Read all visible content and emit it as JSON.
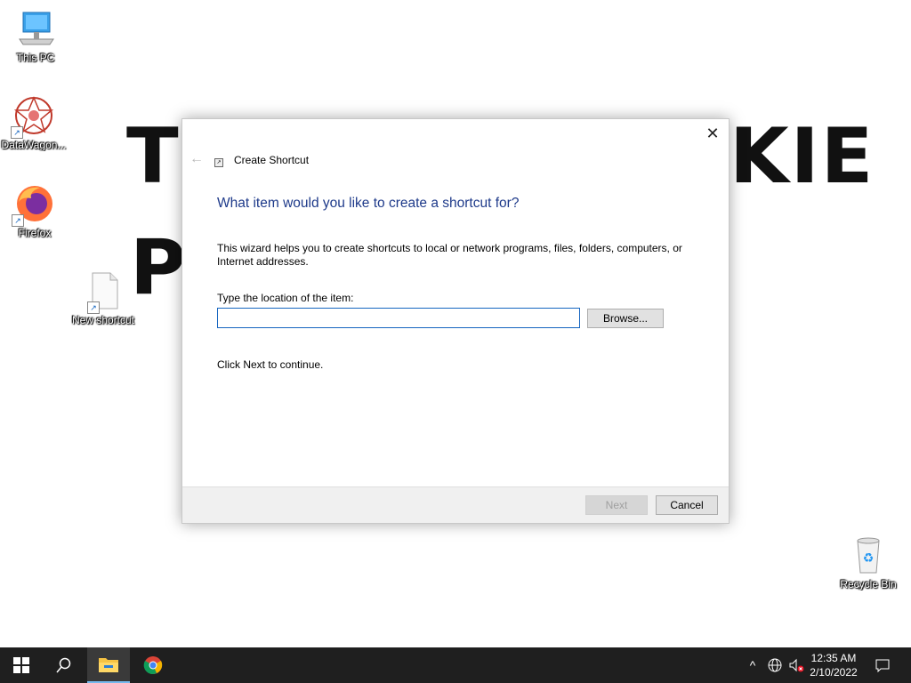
{
  "wallpaper": {
    "line1_left": "T",
    "line1_right": "KIE",
    "line2_left": "P"
  },
  "desktop": {
    "icons": [
      {
        "label": "This PC",
        "icon": "computer-icon"
      },
      {
        "label": "DataWagon...",
        "icon": "datawagon-icon"
      },
      {
        "label": "Firefox",
        "icon": "firefox-icon"
      },
      {
        "label": "New shortcut",
        "icon": "file-icon"
      },
      {
        "label": "Recycle Bin",
        "icon": "recycle-bin-icon"
      }
    ]
  },
  "dialog": {
    "title": "Create Shortcut",
    "heading": "What item would you like to create a shortcut for?",
    "description": "This wizard helps you to create shortcuts to local or network programs, files, folders, computers, or Internet addresses.",
    "location_label": "Type the location of the item:",
    "location_value": "",
    "browse_label": "Browse...",
    "hint": "Click Next to continue.",
    "next_label": "Next",
    "cancel_label": "Cancel",
    "close_glyph": "✕",
    "back_glyph": "←"
  },
  "taskbar": {
    "time": "12:35 AM",
    "date": "2/10/2022",
    "accent": "#76b9ed"
  }
}
